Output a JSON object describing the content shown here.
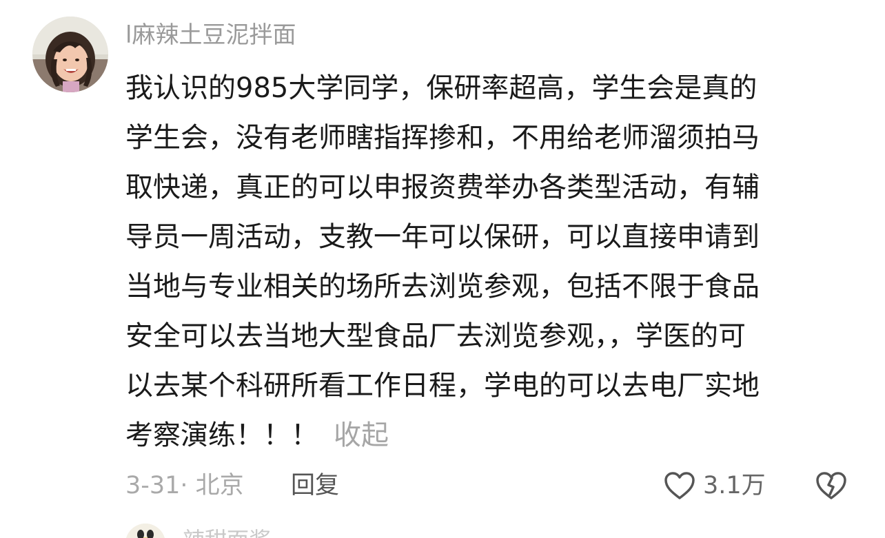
{
  "comment": {
    "username": "l麻辣土豆泥拌面",
    "lines": [
      "我认识的985大学同学，保研率超高，学生会是真的",
      "学生会，没有老师瞎指挥掺和，不用给老师溜须拍马",
      "取快递，真正的可以申报资费举办各类型活动，有辅",
      "导员一周活动，支教一年可以保研，可以直接申请到",
      "当地与专业相关的场所去浏览参观，包括不限于食品",
      "安全可以去当地大型食品厂去浏览参观，，学医的可",
      "以去某个科研所看工作日程，学电的可以去电厂实地",
      "考察演练！！！"
    ],
    "collapse_label": "收起",
    "meta": "3-31· 北京",
    "reply_label": "回复",
    "like_count": "3.1万"
  },
  "next_comment": {
    "username": "辣甜面酱"
  },
  "icons": {
    "like": "heart-outline-icon",
    "dislike": "broken-heart-icon"
  },
  "colors": {
    "text": "#1a1a1a",
    "muted": "#a9a9a9",
    "username": "#9a9a9a"
  }
}
